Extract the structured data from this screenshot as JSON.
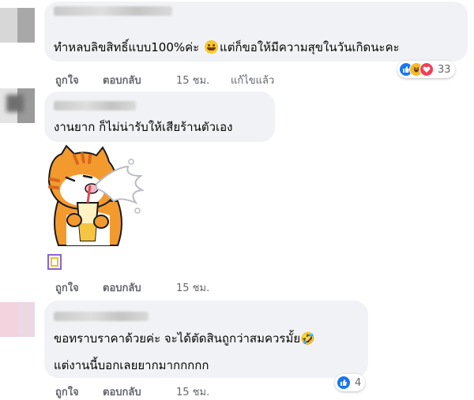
{
  "comments": [
    {
      "text": "ทำหลบลิขสิทธิ์แบบ100%ค่ะ 😅แต่ก็ขอให้มีความสุขในวันเกิดนะคะ",
      "text_before_emoji": "ทำหลบลิขสิทธิ์แบบ100%ค่ะ",
      "text_after_emoji": "แต่ก็ขอให้มีความสุขในวันเกิดนะคะ",
      "actions": {
        "like": "ถูกใจ",
        "reply": "ตอบกลับ",
        "time": "15 ชม.",
        "edited": "แก้ไขแล้ว"
      },
      "reaction_count": "33"
    },
    {
      "text": "งานยาก ก็ไม่น่ารับให้เสียร้านตัวเอง",
      "actions": {
        "like": "ถูกใจ",
        "reply": "ตอบกลับ",
        "time": "15 ชม."
      }
    },
    {
      "text_line1": "ขอทราบราคาด้วยค่ะ จะได้ตัดสินถูกว่าสมควรมั้ย🤣",
      "text_line2": "แต่งานนี้บอกเลยยากมากกกกก",
      "actions": {
        "like": "ถูกใจ",
        "reply": "ตอบกลับ",
        "time": "15 ชม."
      },
      "reaction_count": "4"
    }
  ],
  "colors": {
    "bubble": "#f0f2f5",
    "secondary_text": "#65676b",
    "like_blue": "#1877f2",
    "haha_yellow": "#f7b928",
    "love_red": "#f33e58"
  }
}
